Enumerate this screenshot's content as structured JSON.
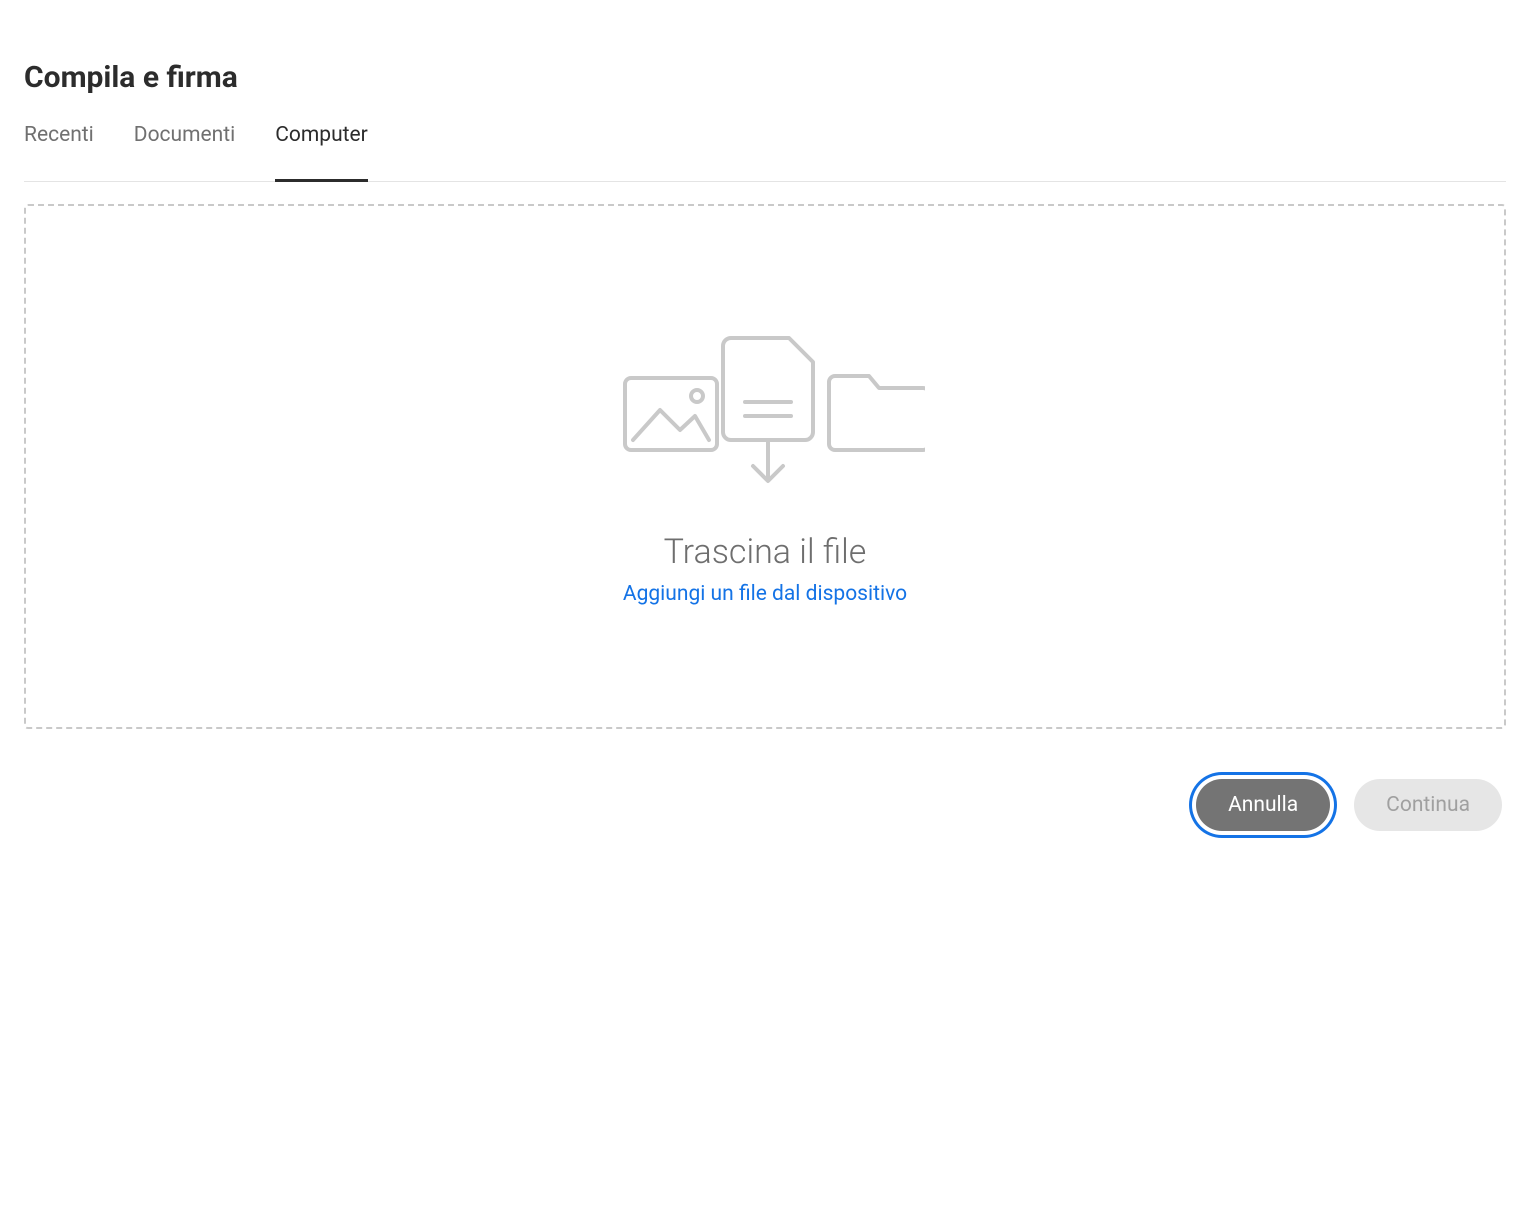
{
  "header": {
    "title": "Compila e firma"
  },
  "tabs": [
    {
      "label": "Recenti",
      "active": false
    },
    {
      "label": "Documenti",
      "active": false
    },
    {
      "label": "Computer",
      "active": true
    }
  ],
  "dropzone": {
    "heading": "Trascina il file",
    "link_text": "Aggiungi un file dal dispositivo"
  },
  "buttons": {
    "cancel": "Annulla",
    "continue": "Continua"
  }
}
